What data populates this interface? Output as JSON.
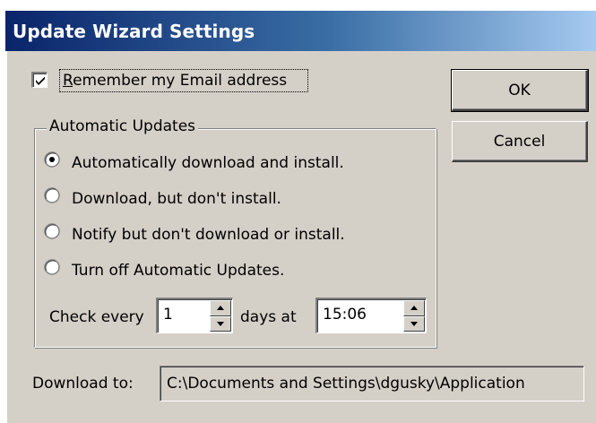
{
  "window": {
    "title": "Update Wizard Settings"
  },
  "remember_email": {
    "label": "Remember my Email address",
    "checked": true
  },
  "buttons": {
    "ok_label": "OK",
    "cancel_label": "Cancel"
  },
  "automatic_updates": {
    "group_label": "Automatic Updates",
    "options": [
      {
        "label": "Automatically download and install.",
        "selected": true
      },
      {
        "label": "Download, but don't install.",
        "selected": false
      },
      {
        "label": "Notify but don't download or install.",
        "selected": false
      },
      {
        "label": "Turn off Automatic Updates.",
        "selected": false
      }
    ],
    "schedule": {
      "check_every_label": "Check every",
      "days_value": "1",
      "days_at_label": "days at",
      "time_value": "15:06"
    }
  },
  "download": {
    "label": "Download to:",
    "path": "C:\\Documents and Settings\\dgusky\\Application"
  },
  "colors": {
    "dialog_face": "#d4d0c8",
    "title_bar_start": "#0a246a",
    "title_bar_end": "#a6caf0",
    "title_text": "#ffffff"
  },
  "icons": {
    "checkmark": "check-icon",
    "radio_selected": "radio-dot-icon",
    "spin_up": "arrow-up-icon",
    "spin_down": "arrow-down-icon"
  }
}
